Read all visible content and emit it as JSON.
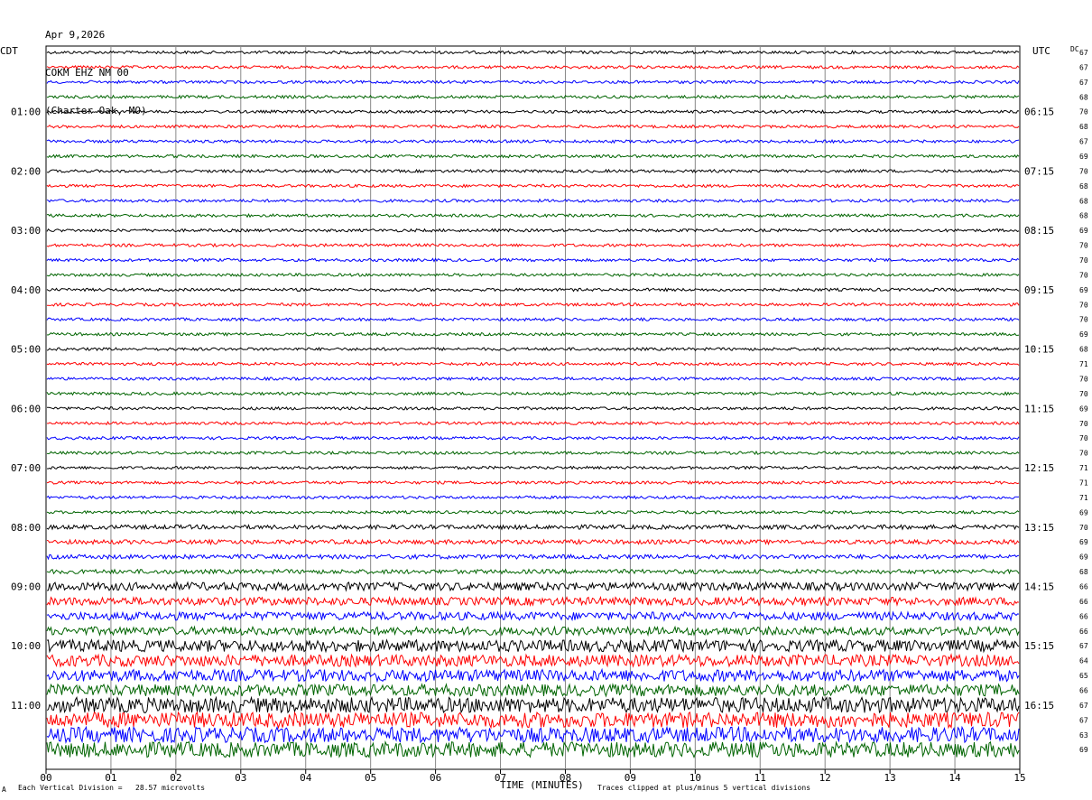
{
  "header": {
    "date": "Apr 9,2026",
    "station": "COKM EHZ NM 00",
    "location": "(Charter Oak, MO)"
  },
  "left_zone": "CDT",
  "right_zone": "UTC",
  "dc_label": "DC",
  "footer": {
    "scale_note": "Each Vertical Division =   28.57 microvolts",
    "clip_note": "Traces clipped at plus/minus 5 vertical divisions",
    "mark": "A"
  },
  "chart_data": {
    "type": "line",
    "title": "",
    "xlabel": "TIME (MINUTES)",
    "xlim": [
      0,
      15
    ],
    "x_ticks": [
      "00",
      "01",
      "02",
      "03",
      "04",
      "05",
      "06",
      "07",
      "08",
      "09",
      "10",
      "11",
      "12",
      "13",
      "14",
      "15"
    ],
    "trace_colors": [
      "#000000",
      "#ff0000",
      "#0000ff",
      "#006400"
    ],
    "trace_count": 48,
    "minutes_per_trace": 15,
    "left_time_labels": [
      "01:00",
      "02:00",
      "03:00",
      "04:00",
      "05:00",
      "06:00",
      "07:00",
      "08:00",
      "09:00",
      "10:00",
      "11:00"
    ],
    "right_time_labels": [
      "06:15",
      "07:15",
      "08:15",
      "09:15",
      "10:15",
      "11:15",
      "12:15",
      "13:15",
      "14:15",
      "15:15",
      "16:15"
    ],
    "dc_offsets": [
      "67",
      "67",
      "67",
      "68",
      "70",
      "68",
      "67",
      "69",
      "70",
      "68",
      "68",
      "68",
      "69",
      "70",
      "70",
      "70",
      "69",
      "70",
      "70",
      "69",
      "68",
      "71",
      "70",
      "70",
      "69",
      "70",
      "70",
      "70",
      "71",
      "71",
      "71",
      "69",
      "70",
      "69",
      "69",
      "68",
      "66",
      "66",
      "66",
      "66",
      "67",
      "64",
      "65",
      "66",
      "67",
      "67",
      "63",
      "69"
    ]
  }
}
